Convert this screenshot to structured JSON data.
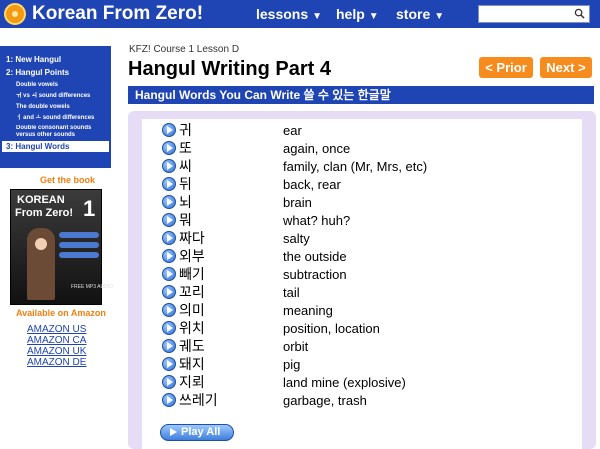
{
  "header": {
    "site_title": "Korean From Zero!",
    "nav": [
      {
        "label": "lessons",
        "caret": "▼"
      },
      {
        "label": "help",
        "caret": "▼"
      },
      {
        "label": "store",
        "caret": "▼"
      }
    ],
    "search_placeholder": ""
  },
  "sidebar": {
    "items": [
      {
        "label": "1: New Hangul"
      },
      {
        "label": "2: Hangul Points"
      },
      {
        "label": "Double vowels"
      },
      {
        "label": "ㅟ vs ㅚ sound differences"
      },
      {
        "label": "The double vowels"
      },
      {
        "label": "ㅓ and ㅗ sound differences"
      },
      {
        "label": "Double consonant sounds versus other sounds"
      },
      {
        "label": "3: Hangul Words"
      }
    ]
  },
  "book": {
    "get_label": "Get the book",
    "cover_line1": "KOREAN",
    "cover_line2": "From Zero!",
    "cover_number": "1",
    "cover_audio": "FREE MP3 AUDIO",
    "available_label": "Available on Amazon",
    "links": [
      "AMAZON US",
      "AMAZON CA",
      "AMAZON UK",
      "AMAZON DE"
    ]
  },
  "main": {
    "breadcrumb": "KFZ! Course 1 Lesson D",
    "title": "Hangul Writing Part 4",
    "prior_label": "< Prior",
    "next_label": "Next >",
    "section_title": "Hangul Words You Can Write 쓸 수 있는 한글말",
    "words": [
      {
        "hangul": "귀",
        "meaning": "ear"
      },
      {
        "hangul": "또",
        "meaning": "again, once"
      },
      {
        "hangul": "씨",
        "meaning": "family, clan (Mr, Mrs, etc)"
      },
      {
        "hangul": "뒤",
        "meaning": "back, rear"
      },
      {
        "hangul": "뇌",
        "meaning": "brain"
      },
      {
        "hangul": "뭐",
        "meaning": "what? huh?"
      },
      {
        "hangul": "짜다",
        "meaning": "salty"
      },
      {
        "hangul": "외부",
        "meaning": "the outside"
      },
      {
        "hangul": "빼기",
        "meaning": "subtraction"
      },
      {
        "hangul": "꼬리",
        "meaning": "tail"
      },
      {
        "hangul": "의미",
        "meaning": "meaning"
      },
      {
        "hangul": "위치",
        "meaning": "position, location"
      },
      {
        "hangul": "궤도",
        "meaning": "orbit"
      },
      {
        "hangul": "돼지",
        "meaning": "pig"
      },
      {
        "hangul": "지뢰",
        "meaning": "land mine (explosive)"
      },
      {
        "hangul": "쓰레기",
        "meaning": "garbage, trash"
      }
    ],
    "play_all_label": "Play All"
  },
  "colors": {
    "brand_blue": "#1f44b4",
    "accent_orange": "#f68b1e",
    "panel_lavender": "#e7dcf5"
  }
}
